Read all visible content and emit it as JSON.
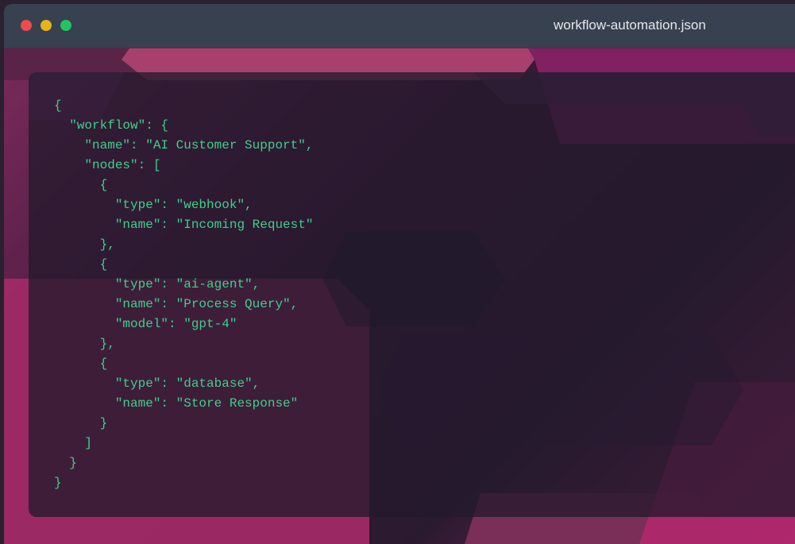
{
  "window": {
    "title": "workflow-automation.json",
    "controls": {
      "close_color": "#ef4b4b",
      "minimize_color": "#e8b21a",
      "maximize_color": "#22c55e"
    }
  },
  "theme": {
    "code_text_color": "#3ed08a",
    "titlebar_color": "#384150"
  },
  "code": {
    "lines": [
      "{",
      "  \"workflow\": {",
      "    \"name\": \"AI Customer Support\",",
      "    \"nodes\": [",
      "      {",
      "        \"type\": \"webhook\",",
      "        \"name\": \"Incoming Request\"",
      "      },",
      "      {",
      "        \"type\": \"ai-agent\",",
      "        \"name\": \"Process Query\",",
      "        \"model\": \"gpt-4\"",
      "      },",
      "      {",
      "        \"type\": \"database\",",
      "        \"name\": \"Store Response\"",
      "      }",
      "    ]",
      "  }",
      "}"
    ]
  }
}
